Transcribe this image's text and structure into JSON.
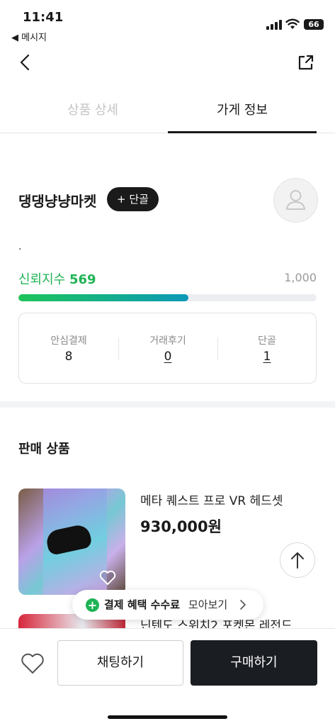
{
  "status_bar": {
    "time": "11:41",
    "back_app": "◀ 메시지",
    "battery": "66"
  },
  "nav": {
    "back_icon": "chevron-left-icon",
    "share_icon": "share-icon"
  },
  "tabs": [
    {
      "label": "상품 상세",
      "active": false
    },
    {
      "label": "가게 정보",
      "active": true
    }
  ],
  "store": {
    "name": "댕댕냥냥마켓",
    "follow_label": "+ 단골",
    "description": ".",
    "trust_label": "신뢰지수",
    "trust_score": "569",
    "trust_max": "1,000",
    "trust_fraction": 0.569,
    "stats": [
      {
        "label": "안심결제",
        "value": "8"
      },
      {
        "label": "거래후기",
        "value": "0"
      },
      {
        "label": "단골",
        "value": "1"
      }
    ]
  },
  "products_section": {
    "title": "판매 상품",
    "items": [
      {
        "title": "메타 퀘스트 프로 VR 헤드셋",
        "price": "930,000원"
      },
      {
        "title": "닌텐도 스위치2 포켓몬 레전드",
        "price": ""
      }
    ]
  },
  "promo": {
    "strong": "결제 혜택 수수료",
    "normal": "모아보기",
    "accent": "#1fb355"
  },
  "bottom_bar": {
    "chat_label": "채팅하기",
    "buy_label": "구매하기"
  },
  "colors": {
    "trust_green": "#1fb355",
    "dark": "#1a1d21"
  }
}
